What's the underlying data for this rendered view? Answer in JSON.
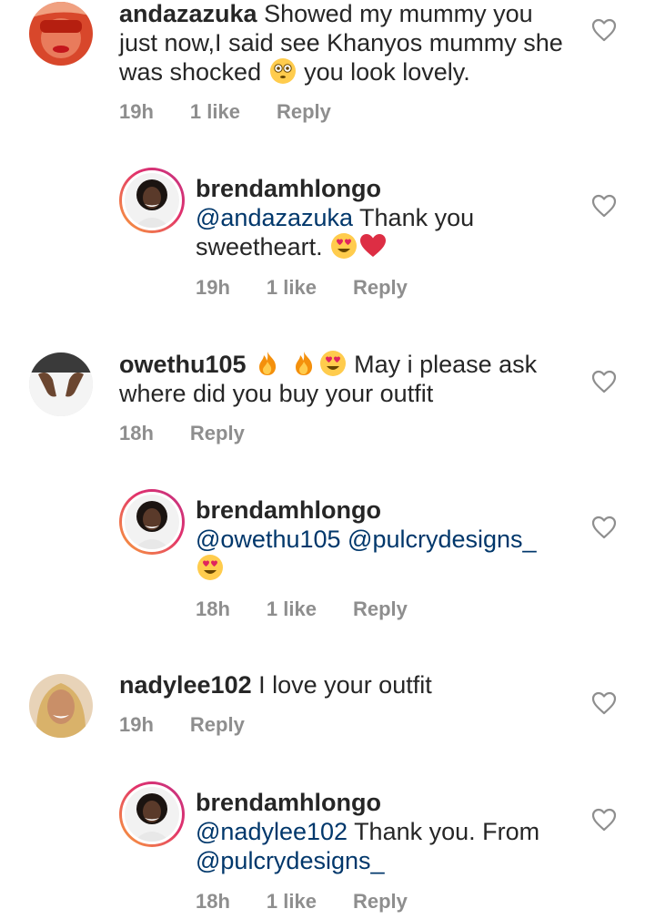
{
  "comments": [
    {
      "username": "andazazuka",
      "text_1": "Showed my mummy you just now,I said see Khanyos mummy she was shocked",
      "text_2": "you look lovely.",
      "time": "19h",
      "likes": "1 like",
      "reply": "Reply",
      "avatar_icon": "profile-photo-red-shades",
      "emojis": [
        "flushed-face"
      ]
    },
    {
      "username": "brendamhlongo",
      "mention": "@andazazuka",
      "text": "Thank you sweetheart.",
      "time": "19h",
      "likes": "1 like",
      "reply": "Reply",
      "avatar_icon": "profile-photo-story-ring",
      "emojis": [
        "heart-eyes",
        "red-heart"
      ]
    },
    {
      "username": "owethu105",
      "text": "May i please ask where did you buy your outfit",
      "time": "18h",
      "reply": "Reply",
      "avatar_icon": "profile-photo-hands",
      "emojis": [
        "fire",
        "fire",
        "heart-eyes"
      ]
    },
    {
      "username": "brendamhlongo",
      "mention": "@owethu105",
      "mention_2": "@pulcrydesigns_",
      "time": "18h",
      "likes": "1 like",
      "reply": "Reply",
      "avatar_icon": "profile-photo-story-ring",
      "emojis": [
        "heart-eyes"
      ]
    },
    {
      "username": "nadylee102",
      "text": "I love your outfit",
      "time": "19h",
      "reply": "Reply",
      "avatar_icon": "profile-photo-blonde"
    },
    {
      "username": "brendamhlongo",
      "mention": "@nadylee102",
      "text": "Thank you. From",
      "mention_2": "@pulcrydesigns_",
      "time": "18h",
      "likes": "1 like",
      "reply": "Reply",
      "avatar_icon": "profile-photo-story-ring"
    }
  ],
  "colors": {
    "text": "#262626",
    "meta": "#8e8e8e",
    "mention": "#00376b",
    "heart_outline": "#8e8e8e"
  }
}
